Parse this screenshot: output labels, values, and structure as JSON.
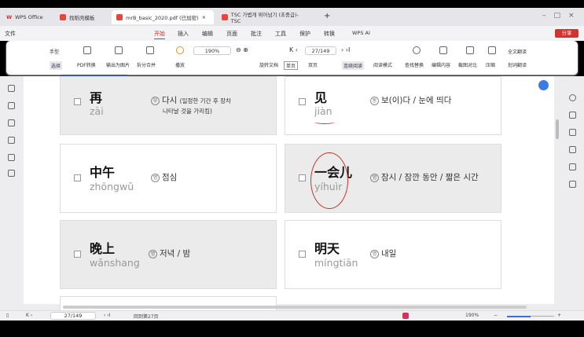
{
  "tabs": [
    {
      "label": "WPS Office"
    },
    {
      "label": "找稻壳模板"
    },
    {
      "label": "mrB_basic_2020.pdf (已加密)",
      "active": true
    },
    {
      "label": "TSC 가볍게 뛰어넘기 (초중급)-TSC"
    }
  ],
  "menu": {
    "file": "文件",
    "items": [
      "开始",
      "插入",
      "编辑",
      "页面",
      "批注",
      "工具",
      "保护",
      "转换"
    ],
    "ai": "WPS AI",
    "share": "分享"
  },
  "toolbar": {
    "hand": "手型",
    "select": "选择",
    "pdf_convert": "PDF转换",
    "export_image": "输出为图片",
    "split_merge": "拆分合并",
    "play": "播放",
    "zoom": "190%",
    "rotate": "旋转文档",
    "single": "单页",
    "double": "双页",
    "continuous": "连续阅读",
    "read_mode": "阅读模式",
    "find_replace": "查找替换",
    "edit_content": "编辑内容",
    "compare": "截图对比",
    "compress": "压缩",
    "translate_full": "全文翻译",
    "translate_word": "划词翻译",
    "page": "27/149"
  },
  "cards": [
    {
      "hanzi": "再",
      "pinyin": "zài",
      "pos": "부",
      "meaning": "다시",
      "note": "(일정한 기간 후 장차",
      "note2": "나타날 것을 가리킴)"
    },
    {
      "hanzi": "见",
      "pinyin": "jiàn",
      "pos": "동",
      "meaning": "보(이)다 / 눈에 띄다"
    },
    {
      "hanzi": "中午",
      "pinyin": "zhōngwǔ",
      "pos": "명",
      "meaning": "점심"
    },
    {
      "hanzi": "一会儿",
      "pinyin": "yíhuìr",
      "pos": "명",
      "meaning": "잠시 / 잠깐 동안 / 짧은 시간"
    },
    {
      "hanzi": "晚上",
      "pinyin": "wǎnshang",
      "pos": "명",
      "meaning": "저녁 / 밤"
    },
    {
      "hanzi": "明天",
      "pinyin": "míngtiān",
      "pos": "명",
      "meaning": "내일"
    }
  ],
  "status": {
    "page": "27/149",
    "goto": "回到第27页",
    "zoom": "190%"
  },
  "colors": {
    "accent": "#d2332c",
    "annotation": "#c0392b"
  }
}
